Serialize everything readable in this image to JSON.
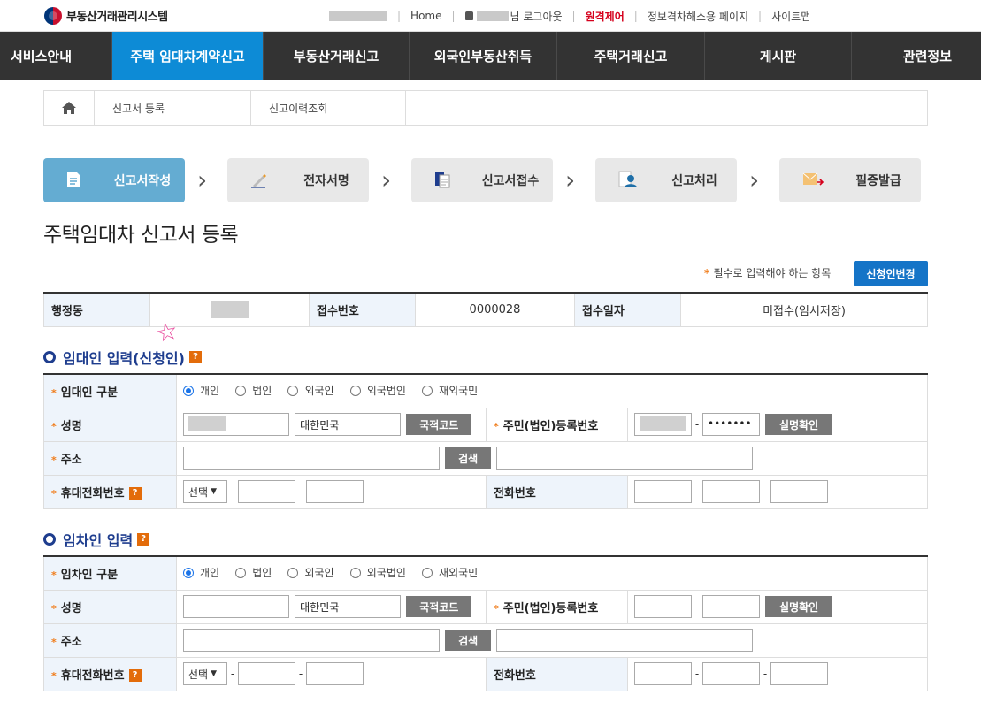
{
  "topbar": {
    "site_title": "부동산거래관리시스템",
    "links": [
      "Home",
      "님 로그아웃",
      "원격제어",
      "정보격차해소용 페이지",
      "사이트맵"
    ]
  },
  "nav": [
    "서비스안내",
    "주택 임대차계약신고",
    "부동산거래신고",
    "외국인부동산취득",
    "주택거래신고",
    "게시판",
    "관련정보"
  ],
  "breadcrumb": {
    "items": [
      "신고서 등록",
      "신고이력조회"
    ]
  },
  "steps": [
    "신고서작성",
    "전자서명",
    "신고서접수",
    "신고처리",
    "필증발급"
  ],
  "page_title": "주택임대차 신고서 등록",
  "required_note": "필수로 입력해야 하는 항목",
  "change_applicant_label": "신청인변경",
  "info": {
    "admin_dong_label": "행정동",
    "receipt_no_label": "접수번호",
    "receipt_no_value": "0000028",
    "receipt_date_label": "접수일자",
    "receipt_date_value": "미접수(임시저장)"
  },
  "lessor": {
    "title": "임대인 입력(신청인)",
    "type_label": "임대인 구분",
    "type_options": [
      "개인",
      "법인",
      "외국인",
      "외국법인",
      "재외국민"
    ],
    "name_label": "성명",
    "nationality_value": "대한민국",
    "country_code_btn": "국적코드",
    "reg_no_label": "주민(법인)등록번호",
    "reg_no_back": "•••••••",
    "verify_btn": "실명확인",
    "address_label": "주소",
    "search_btn": "검색",
    "mobile_label": "휴대전화번호",
    "select_value": "선택",
    "phone_label": "전화번호"
  },
  "lessee": {
    "title": "임차인 입력",
    "type_label": "임차인 구분",
    "type_options": [
      "개인",
      "법인",
      "외국인",
      "외국법인",
      "재외국민"
    ],
    "name_label": "성명",
    "nationality_value": "대한민국",
    "country_code_btn": "국적코드",
    "reg_no_label": "주민(법인)등록번호",
    "verify_btn": "실명확인",
    "address_label": "주소",
    "search_btn": "검색",
    "mobile_label": "휴대전화번호",
    "select_value": "선택",
    "phone_label": "전화번호"
  }
}
